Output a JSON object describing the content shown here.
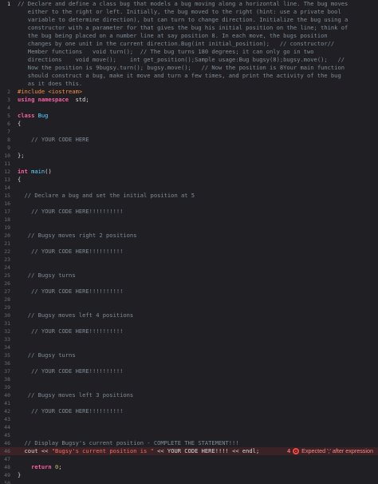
{
  "editor": {
    "first_line_number": "1",
    "header_comment": [
      "// Declare and define a class bug that models a bug moving along a horizontal line. The bug moves",
      "   either to the right or left. Initially, the bug moved to the right (hint: use a private bool",
      "   variable to determine direction), but can turn to change direction. Initialize the bug using a",
      "   constructor with a parameter for that gives the bug his initial position on the line; think of",
      "   the bug being placed on a number line at say position 8. In each move, the bugs position",
      "   changes by one unit in the current direction.Bug(int initial_position);   // constructor//",
      "   Member functions   void turn();  // The bug turns 180 degrees; it can only go in two",
      "   directions    void move();    int get_position();Sample usage:Bug bugsy(8);bugsy.move();   //",
      "   Now the position is 9bugsy.turn(); bugsy.move();   // Now the position is 8Your main function",
      "   should construct a bug, make it move and turn a few times, and print the activity of the bug",
      "   as it does this."
    ],
    "lines": [
      {
        "n": "2",
        "parts": [
          [
            "pp",
            "#include <iostream>"
          ]
        ]
      },
      {
        "n": "3",
        "parts": [
          [
            "kw",
            "using namespace"
          ],
          [
            "",
            "  std;"
          ]
        ]
      },
      {
        "n": "4",
        "parts": []
      },
      {
        "n": "5",
        "parts": [
          [
            "kw",
            "class"
          ],
          [
            "type",
            " Bug"
          ]
        ]
      },
      {
        "n": "6",
        "parts": [
          [
            "",
            "{"
          ]
        ]
      },
      {
        "n": "7",
        "parts": []
      },
      {
        "n": "8",
        "parts": [
          [
            "comment",
            "    // YOUR CODE HERE"
          ]
        ]
      },
      {
        "n": "9",
        "parts": []
      },
      {
        "n": "10",
        "parts": [
          [
            "",
            "};"
          ]
        ]
      },
      {
        "n": "11",
        "parts": []
      },
      {
        "n": "12",
        "parts": [
          [
            "kw",
            "int"
          ],
          [
            "type",
            " main"
          ],
          [
            "",
            "()"
          ]
        ]
      },
      {
        "n": "13",
        "parts": [
          [
            "",
            "{"
          ]
        ]
      },
      {
        "n": "14",
        "parts": []
      },
      {
        "n": "15",
        "parts": [
          [
            "comment",
            "  // Declare a bug and set the initial position at 5"
          ]
        ]
      },
      {
        "n": "16",
        "parts": []
      },
      {
        "n": "17",
        "parts": [
          [
            "comment",
            "    // YOUR CODE HERE!!!!!!!!!!"
          ]
        ]
      },
      {
        "n": "18",
        "parts": []
      },
      {
        "n": "19",
        "parts": []
      },
      {
        "n": "20",
        "parts": [
          [
            "comment",
            "   // Bugsy moves right 2 positions"
          ]
        ]
      },
      {
        "n": "21",
        "parts": []
      },
      {
        "n": "22",
        "parts": [
          [
            "comment",
            "    // YOUR CODE HERE!!!!!!!!!!"
          ]
        ]
      },
      {
        "n": "23",
        "parts": []
      },
      {
        "n": "24",
        "parts": []
      },
      {
        "n": "25",
        "parts": [
          [
            "comment",
            "   // Bugsy turns"
          ]
        ]
      },
      {
        "n": "26",
        "parts": []
      },
      {
        "n": "27",
        "parts": [
          [
            "comment",
            "    // YOUR CODE HERE!!!!!!!!!!"
          ]
        ]
      },
      {
        "n": "28",
        "parts": []
      },
      {
        "n": "29",
        "parts": []
      },
      {
        "n": "30",
        "parts": [
          [
            "comment",
            "   // Bugsy moves left 4 positions"
          ]
        ]
      },
      {
        "n": "31",
        "parts": []
      },
      {
        "n": "32",
        "parts": [
          [
            "comment",
            "    // YOUR CODE HERE!!!!!!!!!!"
          ]
        ]
      },
      {
        "n": "33",
        "parts": []
      },
      {
        "n": "34",
        "parts": []
      },
      {
        "n": "35",
        "parts": [
          [
            "comment",
            "   // Bugsy turns"
          ]
        ]
      },
      {
        "n": "36",
        "parts": []
      },
      {
        "n": "37",
        "parts": [
          [
            "comment",
            "    // YOUR CODE HERE!!!!!!!!!!"
          ]
        ]
      },
      {
        "n": "38",
        "parts": []
      },
      {
        "n": "39",
        "parts": []
      },
      {
        "n": "40",
        "parts": [
          [
            "comment",
            "   // Bugsy moves left 3 positions"
          ]
        ]
      },
      {
        "n": "41",
        "parts": []
      },
      {
        "n": "42",
        "parts": [
          [
            "comment",
            "    // YOUR CODE HERE!!!!!!!!!!"
          ]
        ]
      },
      {
        "n": "43",
        "parts": []
      },
      {
        "n": "44",
        "parts": []
      },
      {
        "n": "45",
        "parts": []
      },
      {
        "n": "46",
        "parts": [
          [
            "comment",
            "  // Display Bugsy's current position - COMPLETE THE STATEMENT!!!"
          ]
        ]
      },
      {
        "n": "46",
        "error": true,
        "parts": [
          [
            "",
            "  cout << "
          ],
          [
            "str",
            "\"Bugsy's current position is \""
          ],
          [
            "",
            " << YOUR CODE HERE!!!! << endl;"
          ]
        ]
      },
      {
        "n": "47",
        "parts": []
      },
      {
        "n": "48",
        "parts": [
          [
            "kw",
            "    return"
          ],
          [
            "num",
            " 0"
          ],
          [
            "",
            ";"
          ]
        ]
      },
      {
        "n": "49",
        "parts": [
          [
            "",
            "}"
          ]
        ]
      },
      {
        "n": "50",
        "parts": []
      }
    ],
    "error": {
      "count": "4",
      "message": "Expected ';' after expression"
    }
  }
}
